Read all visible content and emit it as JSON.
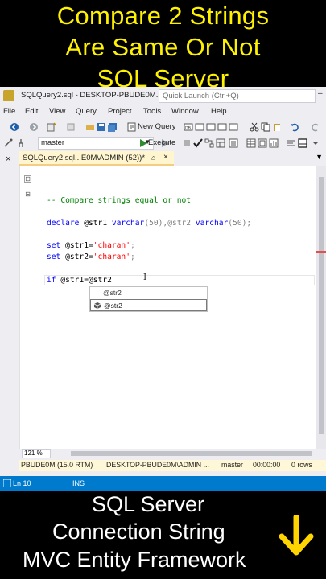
{
  "header_text": [
    "Compare 2 Strings",
    "Are Same Or Not",
    "SQL Server"
  ],
  "window": {
    "title": "SQLQuery2.sql - DESKTOP-PBUDE0M...",
    "quick_launch_placeholder": "Quick Launch (Ctrl+Q)"
  },
  "menu": [
    "File",
    "Edit",
    "View",
    "Query",
    "Project",
    "Tools",
    "Window",
    "Help"
  ],
  "toolbar": {
    "new_query_label": "New Query",
    "database": "master",
    "execute_label": "Execute"
  },
  "tab": {
    "label": "SQLQuery2.sql...E0M\\ADMIN (52))*",
    "pin": "⌂",
    "close": "×"
  },
  "code_lines": {
    "comment": "-- Compare strings equal or not",
    "declare_kw": "declare",
    "declare_p1": " @str1 ",
    "declare_t1": "varchar",
    "declare_p2": "(50),@str2 ",
    "declare_t2": "varchar",
    "declare_p3": "(50);",
    "set_kw": "set",
    "set1_var": " @str1=",
    "set1_val": "'charan'",
    "set_end": ";",
    "set2_var": " @str2=",
    "set2_val": "'charan'",
    "if_kw": "if",
    "if_rest": " @str1=@str2"
  },
  "autocomplete": {
    "items": [
      "@str2",
      "@str2"
    ]
  },
  "editor_status": {
    "zoom": "121 %"
  },
  "status_bar": {
    "server": "PBUDE0M (15.0 RTM)",
    "login": "DESKTOP-PBUDE0M\\ADMIN ...",
    "database": "master",
    "time": "00:00:00",
    "rows": "0 rows"
  },
  "app_status": {
    "line": "Ln 10",
    "mode": "INS"
  },
  "footer_text": [
    "SQL Server",
    "Connection String",
    "MVC Entity Framework"
  ],
  "colors": {
    "header_yellow": "#fff200",
    "status_blue": "#007acc",
    "keyword": "#0000ff",
    "comment": "#008000",
    "string": "#ff0000",
    "arrow": "#ffd400"
  }
}
